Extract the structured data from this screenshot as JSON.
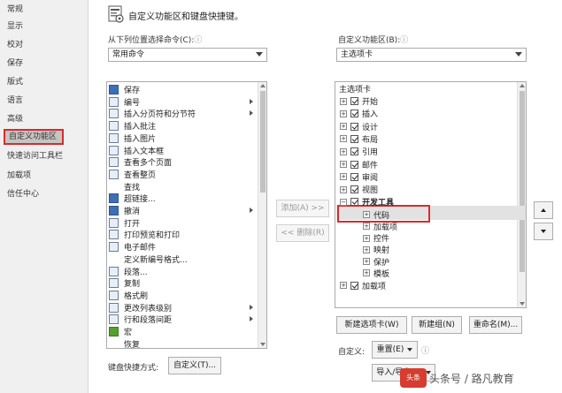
{
  "nav": {
    "items": [
      "常规",
      "显示",
      "校对",
      "保存",
      "版式",
      "语言",
      "高级",
      "自定义功能区",
      "快速访问工具栏",
      "加载项",
      "信任中心"
    ],
    "active_index": 7
  },
  "header": {
    "title": "自定义功能区和键盘快捷键。",
    "icon": "ribbon-settings-icon"
  },
  "left": {
    "label": "从下列位置选择命令(C):",
    "info_icon": "ⓘ",
    "combo_value": "常用命令",
    "commands": [
      {
        "label": "保存",
        "icon": "save-icon",
        "sub": false
      },
      {
        "label": "编号",
        "icon": "numbering-icon",
        "sub": true
      },
      {
        "label": "插入分页符和分节符",
        "icon": "page-break-icon",
        "sub": true
      },
      {
        "label": "插入批注",
        "icon": "comment-icon",
        "sub": false
      },
      {
        "label": "插入图片",
        "icon": "picture-icon",
        "sub": false
      },
      {
        "label": "插入文本框",
        "icon": "textbox-icon",
        "sub": false
      },
      {
        "label": "查看多个页面",
        "icon": "multi-page-icon",
        "sub": false
      },
      {
        "label": "查看整页",
        "icon": "full-page-icon",
        "sub": false
      },
      {
        "label": "查找",
        "icon": "find-icon",
        "sub": false
      },
      {
        "label": "超链接...",
        "icon": "hyperlink-icon",
        "sub": false
      },
      {
        "label": "撤消",
        "icon": "undo-icon",
        "sub": true
      },
      {
        "label": "打开",
        "icon": "open-icon",
        "sub": false
      },
      {
        "label": "打印预览和打印",
        "icon": "print-preview-icon",
        "sub": false
      },
      {
        "label": "电子邮件",
        "icon": "email-icon",
        "sub": false
      },
      {
        "label": "定义新编号格式...",
        "icon": "",
        "sub": false
      },
      {
        "label": "段落...",
        "icon": "paragraph-icon",
        "sub": false
      },
      {
        "label": "复制",
        "icon": "copy-icon",
        "sub": false
      },
      {
        "label": "格式刷",
        "icon": "format-painter-icon",
        "sub": false
      },
      {
        "label": "更改列表级别",
        "icon": "list-level-icon",
        "sub": true
      },
      {
        "label": "行和段落间距",
        "icon": "line-spacing-icon",
        "sub": true
      },
      {
        "label": "宏",
        "icon": "macro-icon",
        "sub": false
      },
      {
        "label": "恢复",
        "icon": "redo-icon",
        "sub": false
      }
    ]
  },
  "middle": {
    "add_label": "添加(A) >>",
    "remove_label": "<< 删除(R)"
  },
  "right": {
    "label": "自定义功能区(B):",
    "info_icon": "ⓘ",
    "combo_value": "主选项卡",
    "tree_header": "主选项卡",
    "tabs": [
      {
        "label": "开始",
        "checked": true
      },
      {
        "label": "插入",
        "checked": true
      },
      {
        "label": "设计",
        "checked": true
      },
      {
        "label": "布局",
        "checked": true
      },
      {
        "label": "引用",
        "checked": true
      },
      {
        "label": "邮件",
        "checked": true
      },
      {
        "label": "审阅",
        "checked": true
      },
      {
        "label": "视图",
        "checked": true
      },
      {
        "label": "开发工具",
        "checked": true,
        "expanded": true
      }
    ],
    "dev_groups": [
      "代码",
      "加载项",
      "控件",
      "映射",
      "保护",
      "模板"
    ],
    "last_tab": {
      "label": "加载项",
      "checked": true
    }
  },
  "buttons": {
    "new_tab": "新建选项卡(W)",
    "new_group": "新建组(N)",
    "rename": "重命名(M)...",
    "customize_label": "自定义:",
    "reset": "重置(E)",
    "import_export": "导入/导出(P)",
    "keyboard_label": "键盘快捷方式:",
    "customize_btn": "自定义(T)...",
    "info_icon": "ⓘ"
  },
  "watermark": {
    "text": "头条号 / 路凡教育",
    "badge": "头条"
  },
  "colors": {
    "highlight_border": "#d92b2b",
    "nav_active_bg": "#c5c5c5"
  }
}
